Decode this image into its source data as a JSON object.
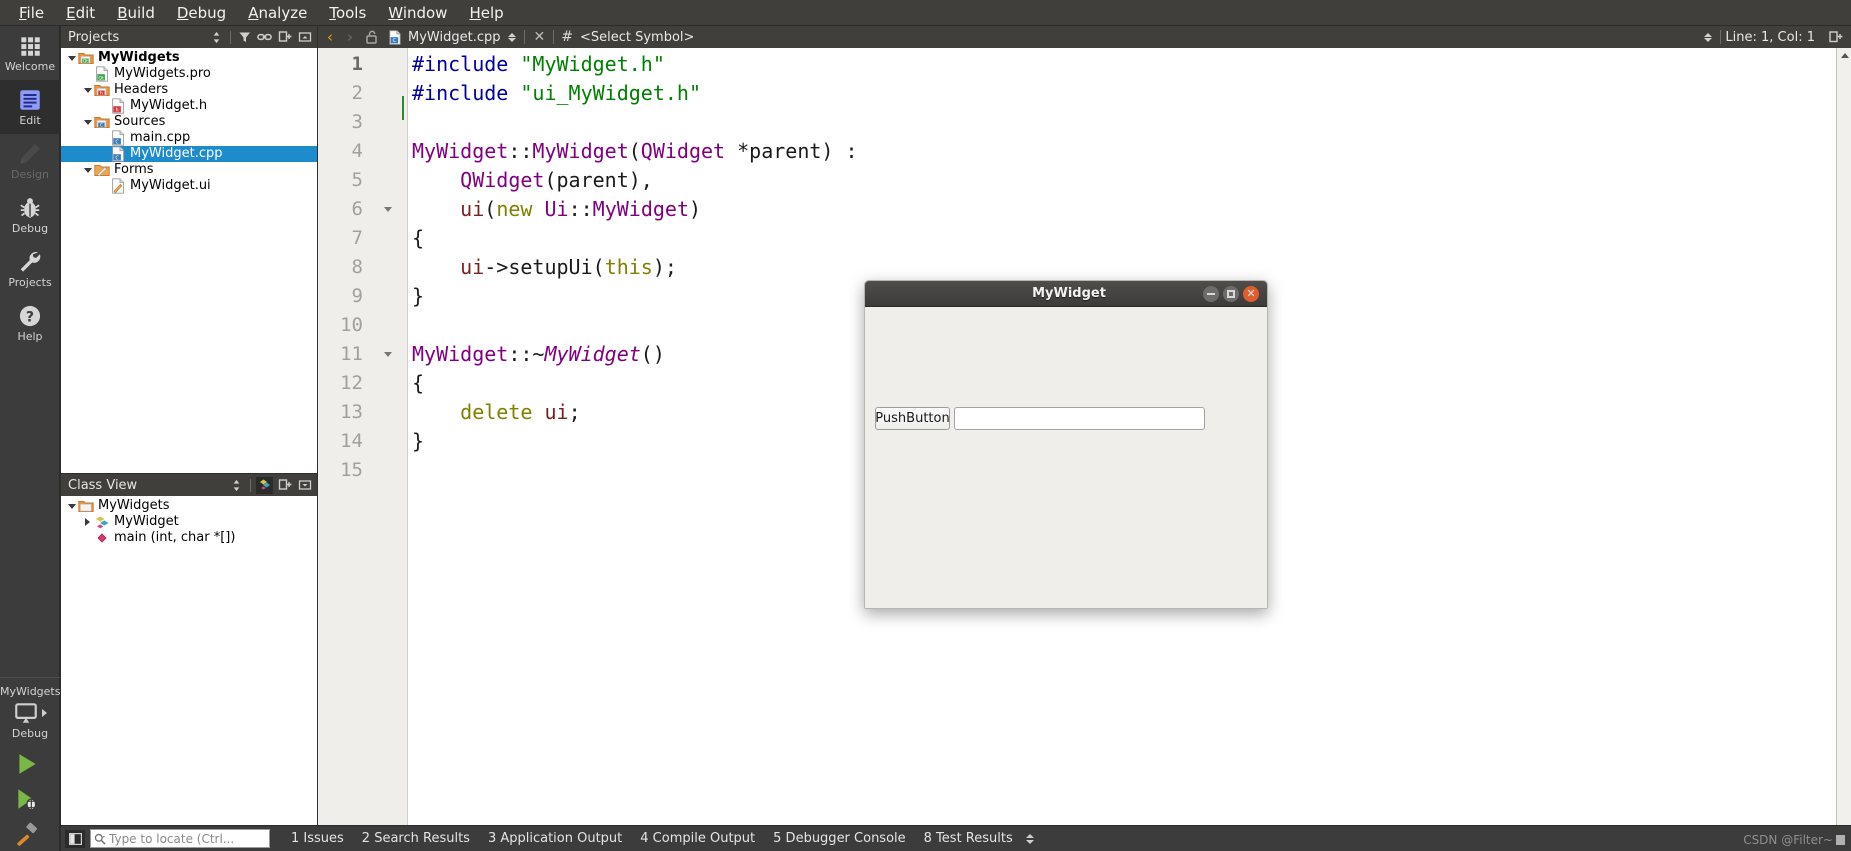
{
  "menubar": {
    "items": [
      {
        "label": "File",
        "mnemonic": "F"
      },
      {
        "label": "Edit",
        "mnemonic": "E"
      },
      {
        "label": "Build",
        "mnemonic": "B"
      },
      {
        "label": "Debug",
        "mnemonic": "D"
      },
      {
        "label": "Analyze",
        "mnemonic": "A"
      },
      {
        "label": "Tools",
        "mnemonic": "T"
      },
      {
        "label": "Window",
        "mnemonic": "W"
      },
      {
        "label": "Help",
        "mnemonic": "H"
      }
    ]
  },
  "modebar": {
    "items": [
      {
        "label": "Welcome",
        "icon": "grid-icon",
        "state": "normal"
      },
      {
        "label": "Edit",
        "icon": "document-lines-icon",
        "state": "active"
      },
      {
        "label": "Design",
        "icon": "pencil-icon",
        "state": "disabled"
      },
      {
        "label": "Debug",
        "icon": "bug-icon",
        "state": "normal"
      },
      {
        "label": "Projects",
        "icon": "wrench-icon",
        "state": "normal"
      },
      {
        "label": "Help",
        "icon": "question-circle-icon",
        "state": "normal"
      }
    ],
    "kit": {
      "project": "MyWidgets",
      "icon": "monitor-icon",
      "build_config": "Debug"
    },
    "actions": [
      {
        "name": "run-button",
        "icon": "green-play-icon"
      },
      {
        "name": "debug-button",
        "icon": "green-play-bug-icon"
      },
      {
        "name": "build-button",
        "icon": "hammer-icon"
      }
    ]
  },
  "projects_dock": {
    "title": "Projects",
    "tools": [
      {
        "name": "sync-spinner-icon",
        "glyph": "spin"
      },
      {
        "name": "filter-icon",
        "glyph": "filter"
      },
      {
        "name": "link-icon",
        "glyph": "link"
      },
      {
        "name": "expand-all-icon",
        "glyph": "expand"
      },
      {
        "name": "collapse-dock-icon",
        "glyph": "collapse"
      }
    ],
    "tree": [
      {
        "label": "MyWidgets",
        "depth": 0,
        "expander": "down",
        "icon": "qt-project-folder-icon",
        "bold": true,
        "selected": false
      },
      {
        "label": "MyWidgets.pro",
        "depth": 1,
        "expander": "none",
        "icon": "qt-pro-file-icon",
        "bold": false,
        "selected": false
      },
      {
        "label": "Headers",
        "depth": 1,
        "expander": "down",
        "icon": "headers-folder-icon",
        "bold": false,
        "selected": false
      },
      {
        "label": "MyWidget.h",
        "depth": 2,
        "expander": "none",
        "icon": "header-file-icon",
        "bold": false,
        "selected": false
      },
      {
        "label": "Sources",
        "depth": 1,
        "expander": "down",
        "icon": "sources-folder-icon",
        "bold": false,
        "selected": false
      },
      {
        "label": "main.cpp",
        "depth": 2,
        "expander": "none",
        "icon": "cpp-file-icon",
        "bold": false,
        "selected": false
      },
      {
        "label": "MyWidget.cpp",
        "depth": 2,
        "expander": "none",
        "icon": "cpp-file-icon",
        "bold": false,
        "selected": true
      },
      {
        "label": "Forms",
        "depth": 1,
        "expander": "down",
        "icon": "forms-folder-icon",
        "bold": false,
        "selected": false
      },
      {
        "label": "MyWidget.ui",
        "depth": 2,
        "expander": "none",
        "icon": "ui-file-icon",
        "bold": false,
        "selected": false
      }
    ]
  },
  "classview_dock": {
    "title": "Class View",
    "tools": [
      {
        "name": "sync-spinner-icon",
        "glyph": "spin"
      },
      {
        "name": "show-subprojects-icon",
        "glyph": "class"
      },
      {
        "name": "expand-all-icon",
        "glyph": "expand"
      },
      {
        "name": "collapse-dock-icon",
        "glyph": "collapse"
      }
    ],
    "tree": [
      {
        "label": "MyWidgets",
        "depth": 0,
        "expander": "down",
        "icon": "folder-icon",
        "selected": false
      },
      {
        "label": "MyWidget",
        "depth": 1,
        "expander": "right",
        "icon": "class-icon",
        "selected": false
      },
      {
        "label": "main (int, char *[])",
        "depth": 1,
        "expander": "none",
        "icon": "function-icon",
        "selected": false
      }
    ]
  },
  "editor_toolbar": {
    "back_arrow": "‹",
    "forward_arrow": "›",
    "lock_icon": "unlocked-padlock-icon",
    "file_icon": "cpp-file-icon",
    "filename": "MyWidget.cpp",
    "close_glyph": "✕",
    "hash_glyph": "#",
    "symbol_selector": "<Select Symbol>",
    "cursor_position": "Line: 1, Col: 1",
    "split_icon": "split-editor-icon"
  },
  "editor": {
    "cursor_line": 1,
    "lines": [
      {
        "n": 1,
        "fold": false,
        "tokens": [
          {
            "t": "#include ",
            "c": "k-pre"
          },
          {
            "t": "\"MyWidget.h\"",
            "c": "k-str"
          }
        ]
      },
      {
        "n": 2,
        "fold": false,
        "tokens": [
          {
            "t": "#include ",
            "c": "k-pre"
          },
          {
            "t": "\"ui_MyWidget.h\"",
            "c": "k-str"
          }
        ]
      },
      {
        "n": 3,
        "fold": false,
        "tokens": []
      },
      {
        "n": 4,
        "fold": false,
        "tokens": [
          {
            "t": "MyWidget",
            "c": "k-type"
          },
          {
            "t": "::",
            "c": "k-txt"
          },
          {
            "t": "MyWidget",
            "c": "k-type"
          },
          {
            "t": "(",
            "c": "k-txt"
          },
          {
            "t": "QWidget",
            "c": "k-type"
          },
          {
            "t": " *parent) :",
            "c": "k-txt"
          }
        ]
      },
      {
        "n": 5,
        "fold": false,
        "tokens": [
          {
            "t": "    ",
            "c": "k-txt"
          },
          {
            "t": "QWidget",
            "c": "k-type"
          },
          {
            "t": "(parent),",
            "c": "k-txt"
          }
        ]
      },
      {
        "n": 6,
        "fold": true,
        "tokens": [
          {
            "t": "    ",
            "c": "k-txt"
          },
          {
            "t": "ui",
            "c": "k-fld"
          },
          {
            "t": "(",
            "c": "k-txt"
          },
          {
            "t": "new",
            "c": "k-kw"
          },
          {
            "t": " ",
            "c": "k-txt"
          },
          {
            "t": "Ui",
            "c": "k-type"
          },
          {
            "t": "::",
            "c": "k-txt"
          },
          {
            "t": "MyWidget",
            "c": "k-type"
          },
          {
            "t": ")",
            "c": "k-txt"
          }
        ]
      },
      {
        "n": 7,
        "fold": false,
        "tokens": [
          {
            "t": "{",
            "c": "k-txt"
          }
        ]
      },
      {
        "n": 8,
        "fold": false,
        "tokens": [
          {
            "t": "    ",
            "c": "k-txt"
          },
          {
            "t": "ui",
            "c": "k-fld"
          },
          {
            "t": "->setupUi(",
            "c": "k-txt"
          },
          {
            "t": "this",
            "c": "k-kw"
          },
          {
            "t": ");",
            "c": "k-txt"
          }
        ]
      },
      {
        "n": 9,
        "fold": false,
        "tokens": [
          {
            "t": "}",
            "c": "k-txt"
          }
        ]
      },
      {
        "n": 10,
        "fold": false,
        "tokens": []
      },
      {
        "n": 11,
        "fold": true,
        "tokens": [
          {
            "t": "MyWidget",
            "c": "k-type"
          },
          {
            "t": "::~",
            "c": "k-txt"
          },
          {
            "t": "MyWidget",
            "c": "k-typei"
          },
          {
            "t": "()",
            "c": "k-txt"
          }
        ]
      },
      {
        "n": 12,
        "fold": false,
        "tokens": [
          {
            "t": "{",
            "c": "k-txt"
          }
        ]
      },
      {
        "n": 13,
        "fold": false,
        "tokens": [
          {
            "t": "    ",
            "c": "k-txt"
          },
          {
            "t": "delete",
            "c": "k-del"
          },
          {
            "t": " ",
            "c": "k-txt"
          },
          {
            "t": "ui",
            "c": "k-fld"
          },
          {
            "t": ";",
            "c": "k-txt"
          }
        ]
      },
      {
        "n": 14,
        "fold": false,
        "tokens": [
          {
            "t": "}",
            "c": "k-txt"
          }
        ]
      },
      {
        "n": 15,
        "fold": false,
        "tokens": []
      }
    ]
  },
  "dialog": {
    "title": "MyWidget",
    "buttons": {
      "minimize": "minimize-icon",
      "maximize": "maximize-icon",
      "close": "close-icon"
    },
    "pushbutton_label": "PushButton",
    "lineedit_value": "",
    "lineedit_placeholder": ""
  },
  "statusbar": {
    "sidebar_toggle_icon": "toggle-sidebar-icon",
    "locator_icon": "search-icon",
    "locator_placeholder": "Type to locate (Ctrl...",
    "panes": [
      {
        "label": "1 Issues"
      },
      {
        "label": "2 Search Results"
      },
      {
        "label": "3 Application Output"
      },
      {
        "label": "4 Compile Output"
      },
      {
        "label": "5 Debugger Console"
      },
      {
        "label": "8 Test Results"
      }
    ]
  },
  "watermark": {
    "text": "CSDN @Filter~"
  },
  "colors": {
    "accent_selection": "#1e8bcd",
    "chrome_dark": "#3c3c3c",
    "chrome_menu": "#413f3c",
    "editor_bg": "#ffffff",
    "gutter_bg": "#efeeea",
    "string_green": "#008000",
    "type_purple": "#800080",
    "preproc_blue": "#0000a0",
    "keyword_olive": "#808000",
    "field_maroon": "#7a1f1f",
    "close_orange": "#e05d2e",
    "run_green": "#7ab648"
  }
}
